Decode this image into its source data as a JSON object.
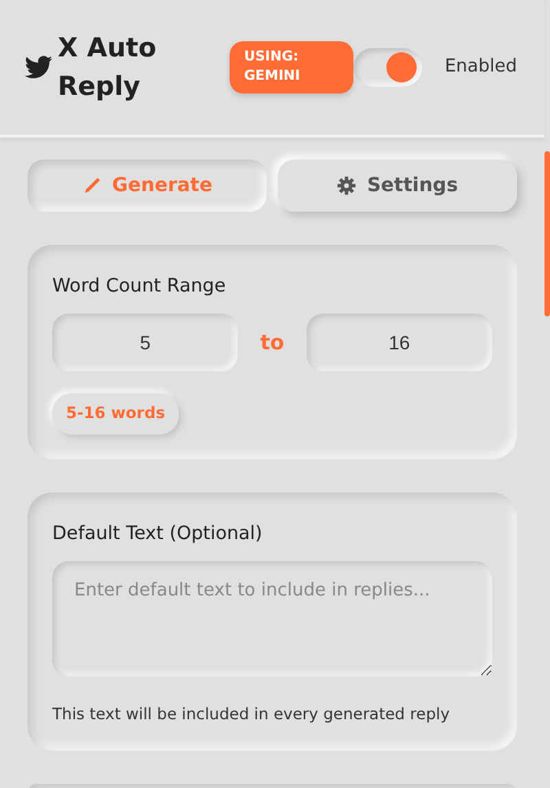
{
  "header": {
    "title": "X Auto Reply",
    "provider_badge": "USING: GEMINI",
    "toggle": {
      "on": true
    },
    "toggle_label": "Enabled"
  },
  "tabs": [
    {
      "label": "Generate",
      "selected": true
    },
    {
      "label": "Settings",
      "selected": false
    }
  ],
  "word_count": {
    "label": "Word Count Range",
    "min": "5",
    "separator": "to",
    "max": "16",
    "summary": "5-16 words"
  },
  "default_text": {
    "label": "Default Text (Optional)",
    "placeholder": "Enter default text to include in replies...",
    "help": "This text will be included in every generated reply"
  }
}
